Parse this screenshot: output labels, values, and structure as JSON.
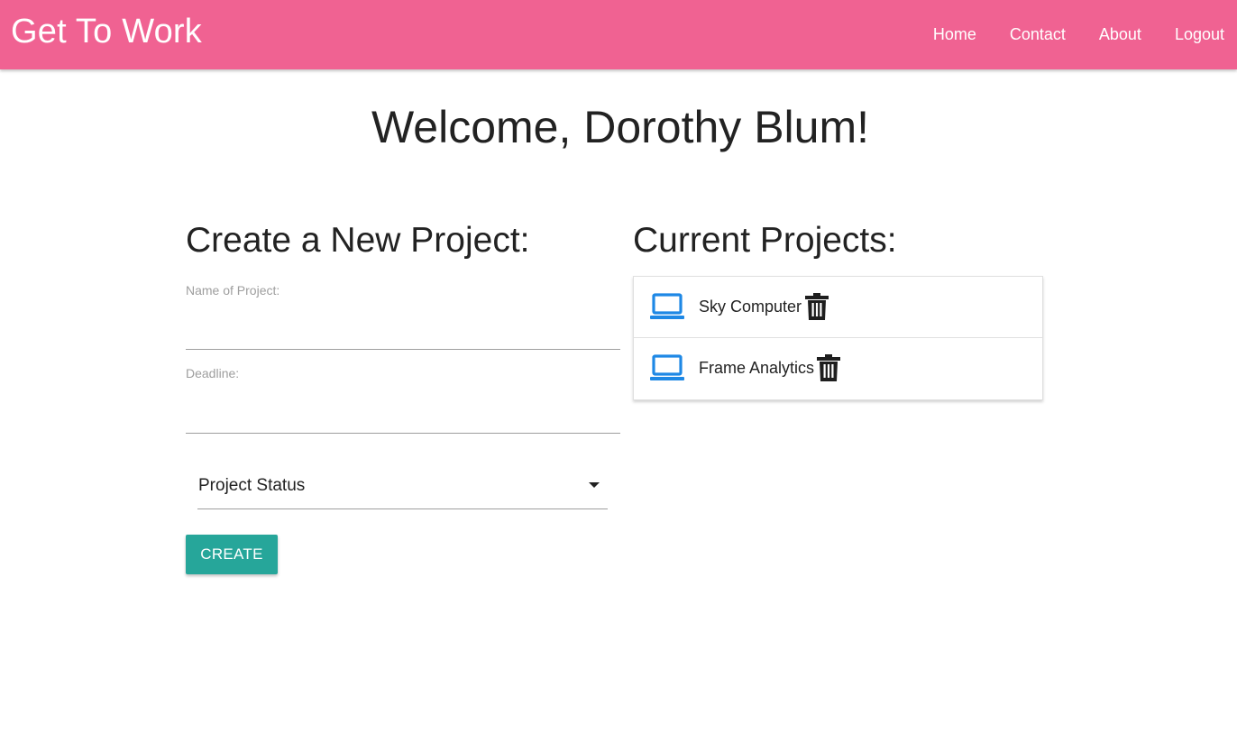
{
  "navbar": {
    "brand": "Get To Work",
    "links": [
      "Home",
      "Contact",
      "About",
      "Logout"
    ],
    "color": "#f06292"
  },
  "welcome": "Welcome, Dorothy Blum!",
  "create_form": {
    "title": "Create a New Project:",
    "name_label": "Name of Project:",
    "name_value": "",
    "deadline_label": "Deadline:",
    "deadline_value": "",
    "status_selected": "Project Status",
    "submit_label": "CREATE",
    "submit_color": "#26a69a"
  },
  "current_projects": {
    "title": "Current Projects:",
    "icon_color": "#1e88e5",
    "items": [
      {
        "name": "Sky Computer",
        "icon": "laptop-icon",
        "action_icon": "trash-icon"
      },
      {
        "name": "Frame Analytics",
        "icon": "laptop-icon",
        "action_icon": "trash-icon"
      }
    ]
  }
}
